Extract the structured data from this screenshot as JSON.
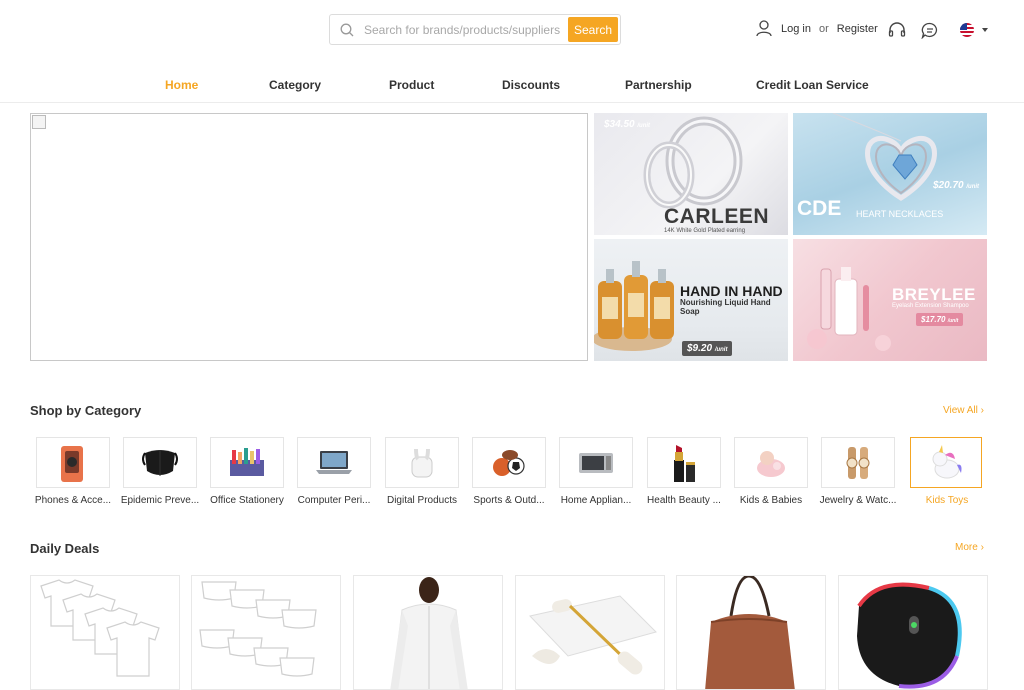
{
  "header": {
    "search_placeholder": "Search for brands/products/suppliers",
    "search_button": "Search",
    "login": "Log in",
    "or": "or",
    "register": "Register"
  },
  "nav": [
    {
      "label": "Home",
      "active": true
    },
    {
      "label": "Category"
    },
    {
      "label": "Product"
    },
    {
      "label": "Discounts"
    },
    {
      "label": "Partnership"
    },
    {
      "label": "Credit Loan Service"
    }
  ],
  "promos": [
    {
      "price": "$34.50",
      "unit": "/unit",
      "brand": "CARLEEN",
      "sub": "14K White Gold Plated earring"
    },
    {
      "price": "$20.70",
      "unit": "/unit",
      "brand": "CDE",
      "sub": "HEART NECKLACES"
    },
    {
      "price": "$9.20",
      "unit": "/unit",
      "brand": "HAND IN HAND",
      "sub": "Nourishing Liquid Hand Soap"
    },
    {
      "price": "$17.70",
      "unit": "/unit",
      "brand": "BREYLEE",
      "sub": "Eyelash Extension Shampoo"
    }
  ],
  "categories": {
    "title": "Shop by Category",
    "view_all": "View All",
    "items": [
      {
        "label": "Phones & Acce...",
        "icon": "phone-icon"
      },
      {
        "label": "Epidemic Preve...",
        "icon": "mask-icon"
      },
      {
        "label": "Office Stationery",
        "icon": "stationery-icon"
      },
      {
        "label": "Computer Peri...",
        "icon": "laptop-icon"
      },
      {
        "label": "Digital Products",
        "icon": "earbuds-icon"
      },
      {
        "label": "Sports & Outd...",
        "icon": "balls-icon"
      },
      {
        "label": "Home Applian...",
        "icon": "microwave-icon"
      },
      {
        "label": "Health Beauty ...",
        "icon": "lipstick-icon"
      },
      {
        "label": "Kids & Babies",
        "icon": "baby-icon"
      },
      {
        "label": "Jewelry & Watc...",
        "icon": "watch-icon"
      },
      {
        "label": "Kids Toys",
        "icon": "unicorn-icon",
        "active": true
      }
    ]
  },
  "deals": {
    "title": "Daily Deals",
    "more": "More",
    "items": [
      "white-tshirts",
      "white-briefs",
      "white-hoodie",
      "jade-roller",
      "brown-handbag",
      "rgb-mouse"
    ]
  },
  "colors": {
    "accent": "#f5a623"
  }
}
